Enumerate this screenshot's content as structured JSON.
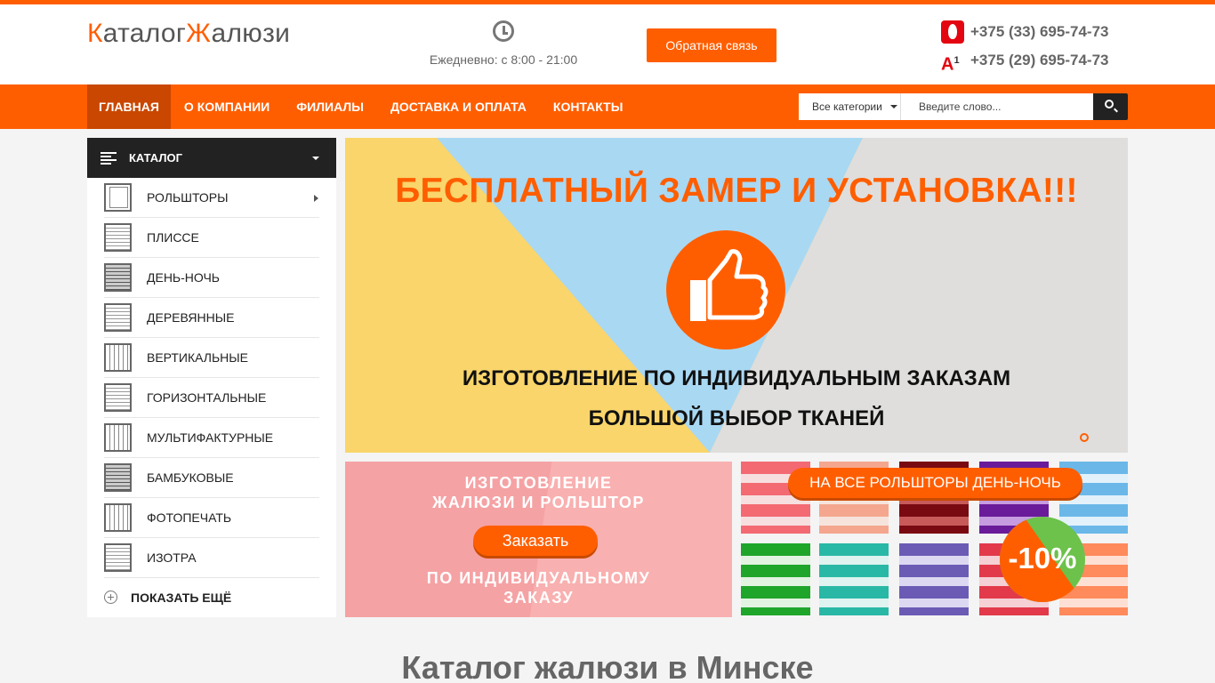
{
  "brand": {
    "logo_k": "К",
    "logo_mid": "аталог",
    "logo_zh": "Ж",
    "logo_end": "алюзи",
    "accent": "#ff5e00"
  },
  "header": {
    "hours": "Ежедневно: с 8:00 - 21:00",
    "callback_label": "Обратная связь",
    "phone_mts": "+375 (33) 695-74-73",
    "phone_a1": "+375 (29) 695-74-73",
    "icons": {
      "clock": "clock-icon",
      "mts": "mts-logo-icon",
      "a1": "a1-logo-icon"
    }
  },
  "nav": {
    "items": [
      {
        "label": "ГЛАВНАЯ",
        "active": true
      },
      {
        "label": "О КОМПАНИИ"
      },
      {
        "label": "ФИЛИАЛЫ"
      },
      {
        "label": "ДОСТАВКА И ОПЛАТА"
      },
      {
        "label": "КОНТАКТЫ"
      }
    ]
  },
  "search": {
    "category": "Все категории",
    "placeholder": "Введите слово..."
  },
  "catalog": {
    "title": "КАТАЛОГ",
    "items": [
      {
        "label": "РОЛЬШТОРЫ"
      },
      {
        "label": "ПЛИССЕ"
      },
      {
        "label": "ДЕНЬ-НОЧЬ"
      },
      {
        "label": "ДЕРЕВЯННЫЕ"
      },
      {
        "label": "ВЕРТИКАЛЬНЫЕ"
      },
      {
        "label": "ГОРИЗОНТАЛЬНЫЕ"
      },
      {
        "label": "МУЛЬТИФАКТУРНЫЕ"
      },
      {
        "label": "БАМБУКОВЫЕ"
      },
      {
        "label": "ФОТОПЕЧАТЬ"
      },
      {
        "label": "ИЗОТРА"
      }
    ],
    "show_more": "ПОКАЗАТЬ ЕЩЁ"
  },
  "slider": {
    "headline": "БЕСПЛАТНЫЙ ЗАМЕР И УСТАНОВКА!!!",
    "line1": "ИЗГОТОВЛЕНИЕ ПО ИНДИВИДУАЛЬНЫМ ЗАКАЗАМ",
    "line2": "БОЛЬШОЙ ВЫБОР ТКАНЕЙ",
    "icon": "thumbs-up-icon"
  },
  "banner1": {
    "line1": "ИЗГОТОВЛЕНИЕ",
    "line2": "ЖАЛЮЗИ И РОЛЬШТОР",
    "button": "Заказать",
    "line4": "ПО ИНДИВИДУАЛЬНОМУ",
    "line5": "ЗАКАЗУ"
  },
  "banner2": {
    "pill": "НА ВСЕ РОЛЬШТОРЫ ДЕНЬ-НОЧЬ",
    "badge": "-10%"
  },
  "page": {
    "title": "Каталог жалюзи в Минске"
  }
}
